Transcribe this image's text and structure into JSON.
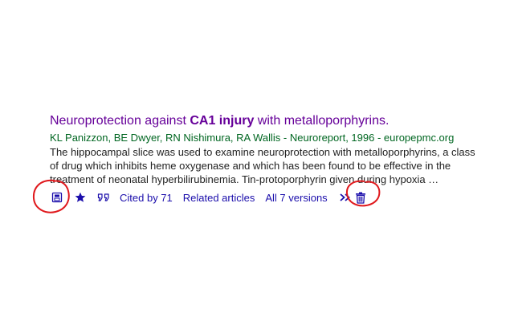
{
  "result": {
    "title_before": "Neuroprotection against ",
    "title_bold": "CA1 injury",
    "title_after": " with metalloporphyrins.",
    "authors": "KL Panizzon, BE Dwyer, RN Nishimura, RA Wallis - Neuroreport, 1996 - europepmc.org",
    "snippet_lines": [
      "The hippocampal slice was used to examine neuroprotection with metalloporphyrins, a class",
      "of drug which inhibits heme oxygenase and which has been found to be effective in the",
      "treatment of neonatal hyperbilirubinemia. Tin-protoporphyrin given during hypoxia …"
    ]
  },
  "actions": {
    "cited_by": "Cited by 71",
    "related": "Related articles",
    "versions": "All 7 versions"
  },
  "icons": {
    "save": "save-icon",
    "star": "star-icon",
    "cite": "cite-quote-icon",
    "more": "double-chevron-icon",
    "trash": "trash-icon"
  },
  "colors": {
    "title": "#660099",
    "authors": "#006621",
    "link": "#1a0dab",
    "annotation": "#e0191d"
  }
}
